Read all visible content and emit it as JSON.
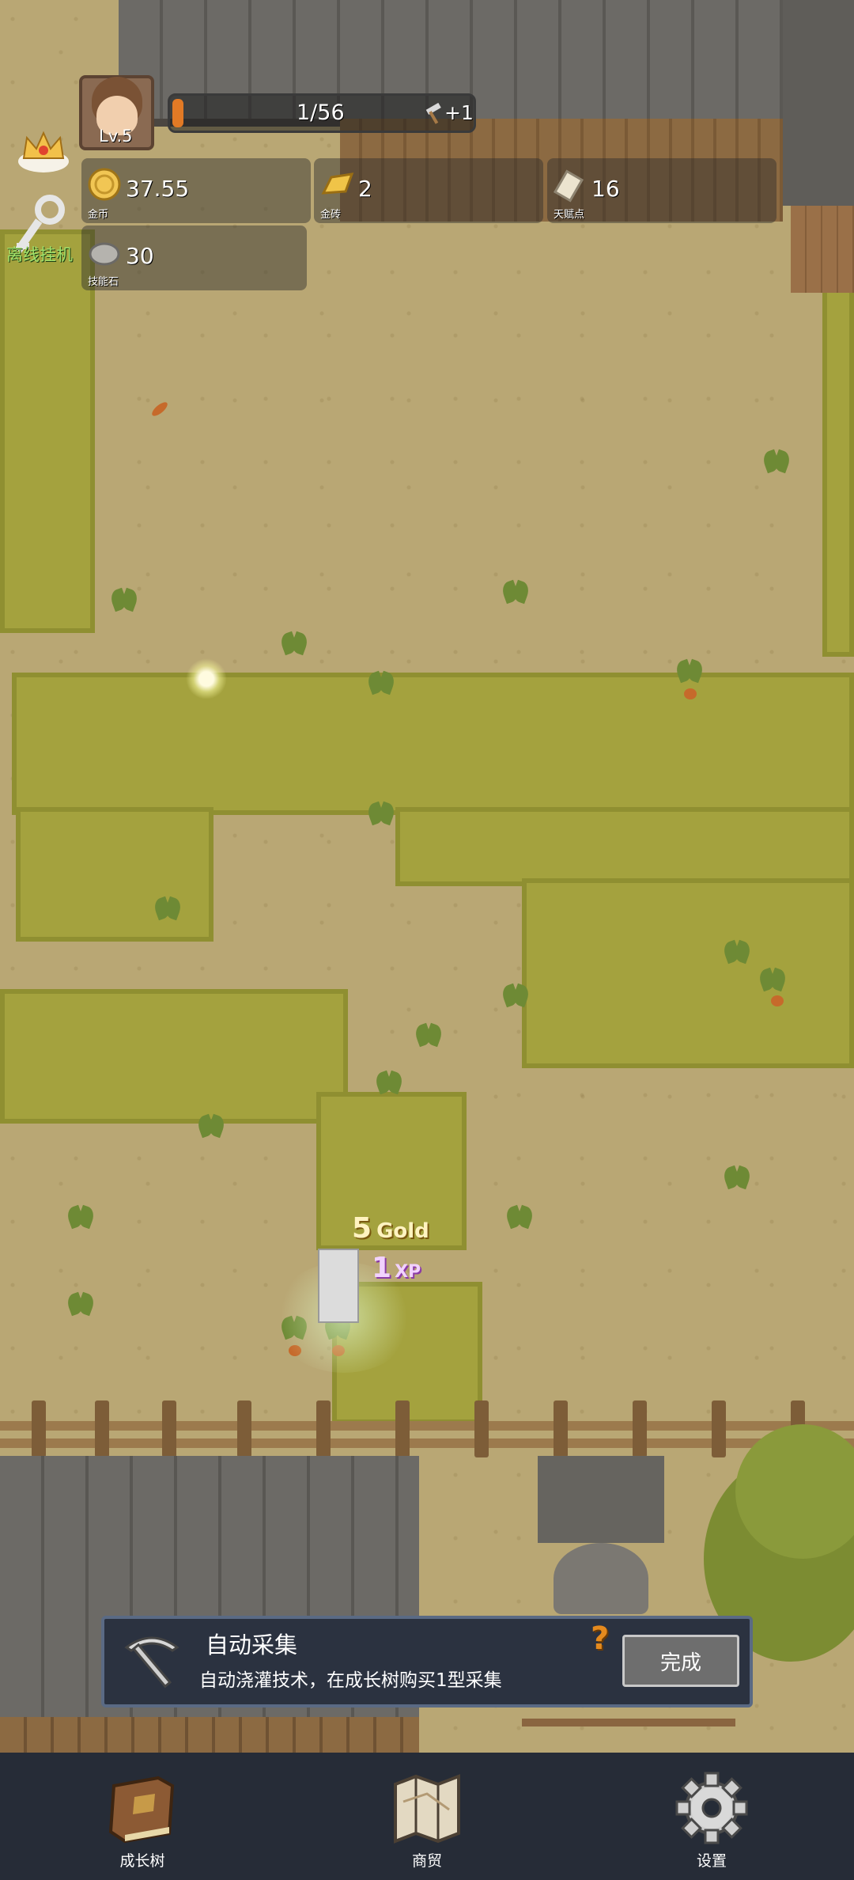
{
  "player": {
    "level": "Lv.5",
    "xp_text": "1/56",
    "xp_progress": 0.018,
    "tool_bonus": "+1"
  },
  "idle_label": "离线挂机",
  "resources": {
    "gold": {
      "value": "37.55",
      "label": "金币",
      "icon": "gold-coin-icon"
    },
    "gold_bar": {
      "value": "2",
      "label": "金砖",
      "icon": "gold-bar-icon"
    },
    "talent": {
      "value": "16",
      "label": "天赋点",
      "icon": "scroll-icon"
    },
    "skill_stone": {
      "value": "30",
      "label": "技能石",
      "icon": "stone-icon"
    }
  },
  "gain": {
    "gold_num": "5",
    "gold_unit": "Gold",
    "xp_num": "1",
    "xp_unit": "XP"
  },
  "quest": {
    "title": "自动采集",
    "description": "自动浇灌技术，在成长树购买1型采集",
    "help": "?",
    "done_label": "完成"
  },
  "nav": {
    "items": [
      {
        "label": "成长树",
        "icon": "book-icon"
      },
      {
        "label": "商贸",
        "icon": "map-icon"
      },
      {
        "label": "设置",
        "icon": "gear-icon"
      }
    ]
  },
  "colors": {
    "nav_bg": "#262c37",
    "quest_bg": "#2b3240",
    "xp_fill": "#e27a25",
    "help": "#e58a1e",
    "idle_text": "#9fe06a"
  }
}
